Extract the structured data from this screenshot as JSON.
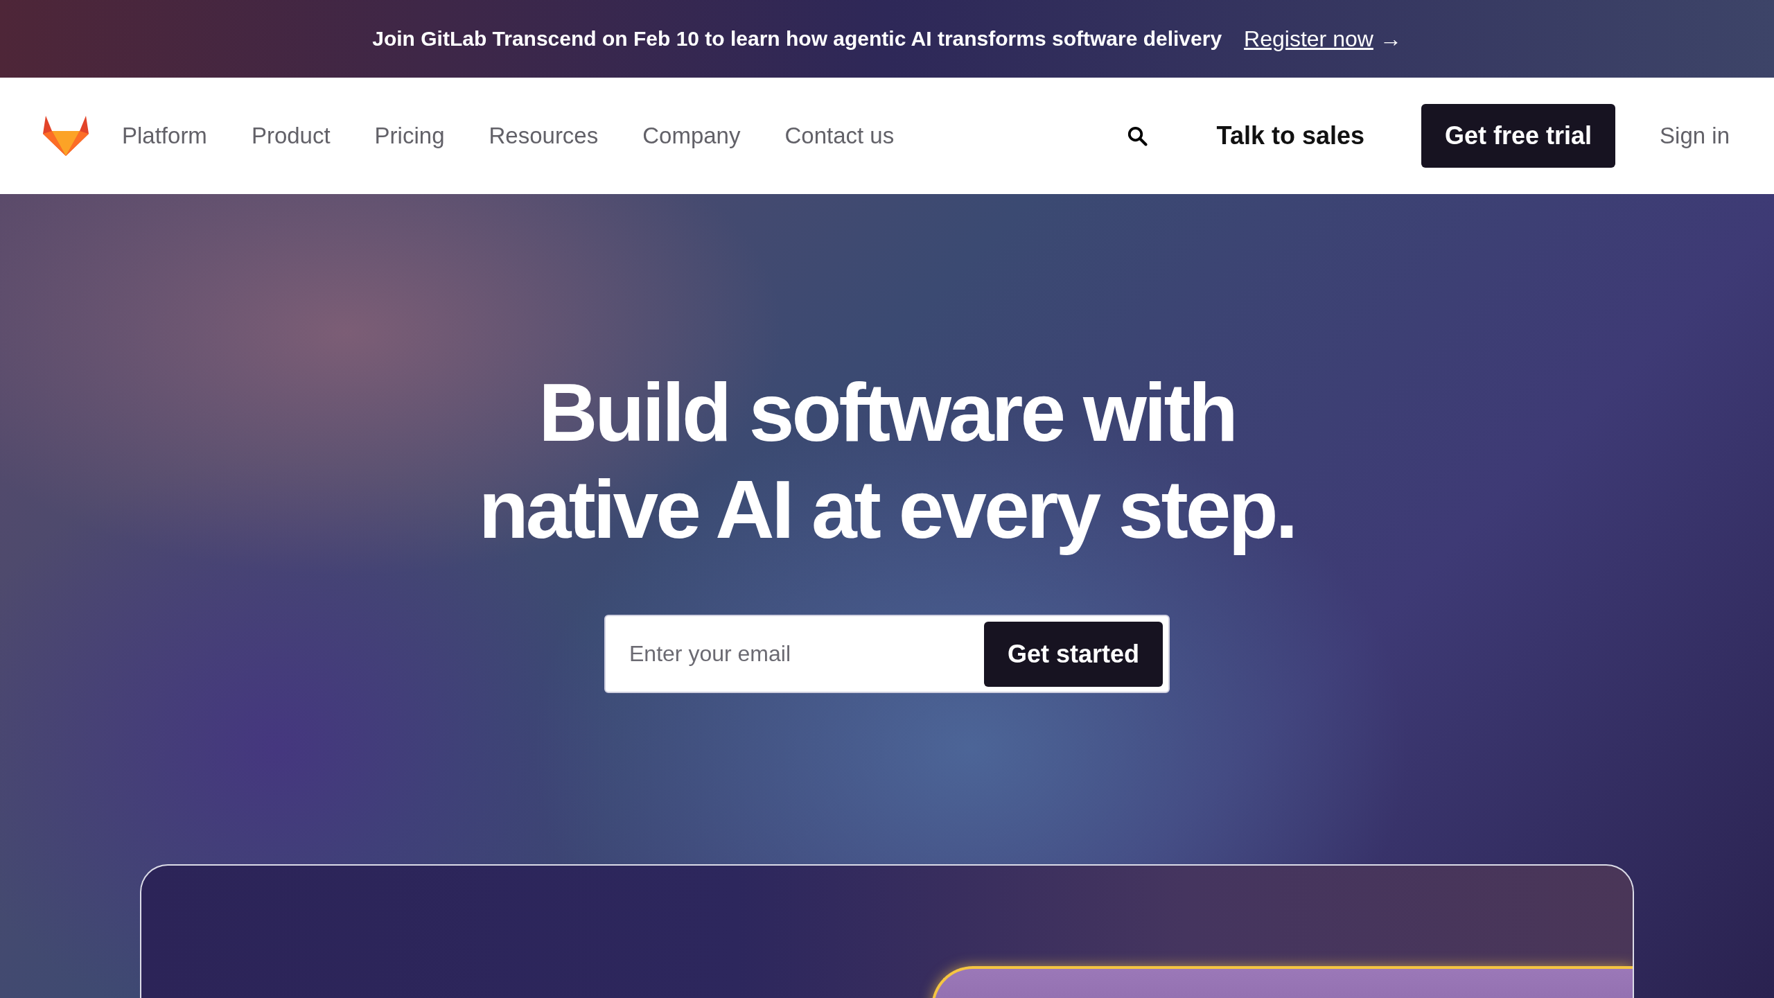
{
  "banner": {
    "text": "Join GitLab Transcend on Feb 10 to learn how agentic AI transforms software delivery",
    "link": "Register now",
    "link_arrow": "→"
  },
  "nav": {
    "items": [
      "Platform",
      "Product",
      "Pricing",
      "Resources",
      "Company",
      "Contact us"
    ],
    "talk_to_sales": "Talk to sales",
    "trial_button": "Get free trial",
    "sign_in": "Sign in"
  },
  "hero": {
    "headline_lines": [
      "Build software with",
      "native AI at every step."
    ],
    "email": {
      "placeholder": "Enter your email"
    },
    "submit": "Get started"
  }
}
